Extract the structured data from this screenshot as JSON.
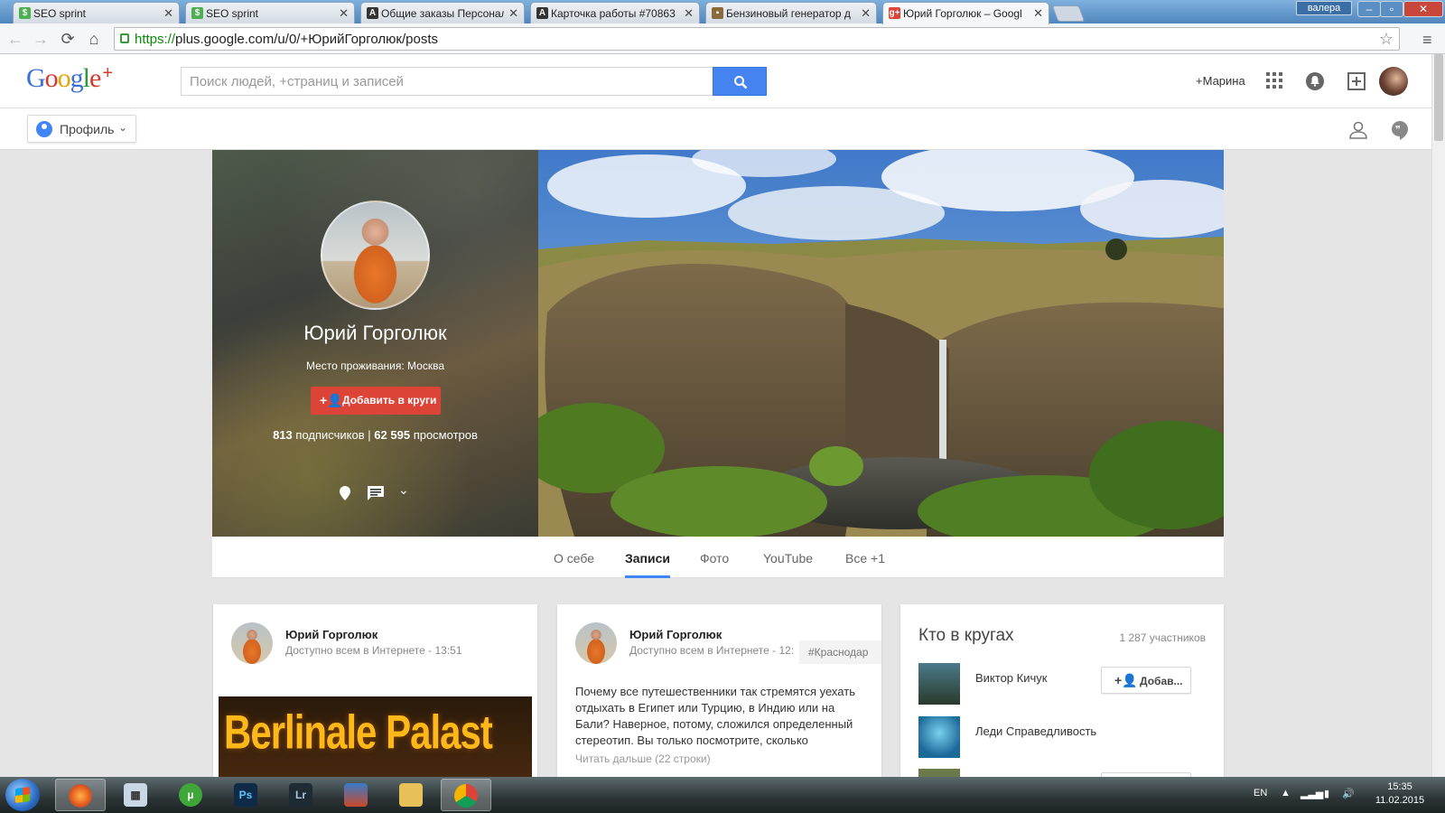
{
  "browser": {
    "tabs": [
      {
        "title": "SEO sprint",
        "favicon": "seosprint-icon",
        "color": "#4caf50"
      },
      {
        "title": "SEO sprint",
        "favicon": "seosprint-icon",
        "color": "#4caf50"
      },
      {
        "title": "Общие заказы Персонал",
        "favicon": "letter-a-icon",
        "color": "#333333"
      },
      {
        "title": "Карточка работы #70863",
        "favicon": "letter-a-icon",
        "color": "#333333"
      },
      {
        "title": "Бензиновый генератор д",
        "favicon": "shop-icon",
        "color": "#8a6a3a"
      },
      {
        "title": "Юрий Горголюк – Googl",
        "favicon": "google-plus-icon",
        "color": "#db4437"
      }
    ],
    "user_badge": "валера",
    "url_scheme": "https://",
    "url_rest": "plus.google.com/u/0/+ЮрийГорголюк/posts"
  },
  "gplus": {
    "logo": {
      "g1": "G",
      "o1": "o",
      "o2": "o",
      "g2": "g",
      "l": "l",
      "e": "e",
      "plus": "+"
    },
    "search_placeholder": "Поиск людей, +страниц и записей",
    "user_link": "+Марина",
    "profile_menu": "Профиль"
  },
  "profile": {
    "name": "Юрий Горголюк",
    "location": "Место проживания: Москва",
    "add_button": "Добавить в круги",
    "followers_count": "813",
    "followers_label": "подписчиков",
    "separator": "|",
    "views_count": "62 595",
    "views_label": "просмотров"
  },
  "tabs": [
    {
      "label": "О себе",
      "active": false
    },
    {
      "label": "Записи",
      "active": true
    },
    {
      "label": "Фото",
      "active": false
    },
    {
      "label": "YouTube",
      "active": false
    },
    {
      "label": "Все +1",
      "active": false
    }
  ],
  "posts": [
    {
      "author": "Юрий Горголюк",
      "meta": "Доступно всем в Интернете  -  13:51",
      "image_text": "Berlinale Palast"
    },
    {
      "author": "Юрий Горголюк",
      "meta": "Доступно всем в Интернете  -  12:",
      "hashtag": "#Краснодар",
      "text": "Почему все путешественники так стремятся уехать отдыхать в Египет или Турцию, в Индию или на Бали? Наверное, потому,  сложился определенный стереотип. Вы только посмотрите, сколько",
      "read_more": "Читать дальше (22 строки)"
    }
  ],
  "circles": {
    "title": "Кто в кругах",
    "count": "1 287 участников",
    "people": [
      {
        "name": "Виктор Кичук",
        "button": "Добав..."
      },
      {
        "name": "Леди Справедливость",
        "button": ""
      }
    ]
  },
  "taskbar": {
    "lang": "EN",
    "time": "15:35",
    "date": "11.02.2015",
    "apps": [
      "firefox-icon",
      "calculator-icon",
      "utorrent-icon",
      "photoshop-icon",
      "lightroom-icon",
      "app-icon",
      "folder-icon",
      "chrome-icon"
    ]
  }
}
